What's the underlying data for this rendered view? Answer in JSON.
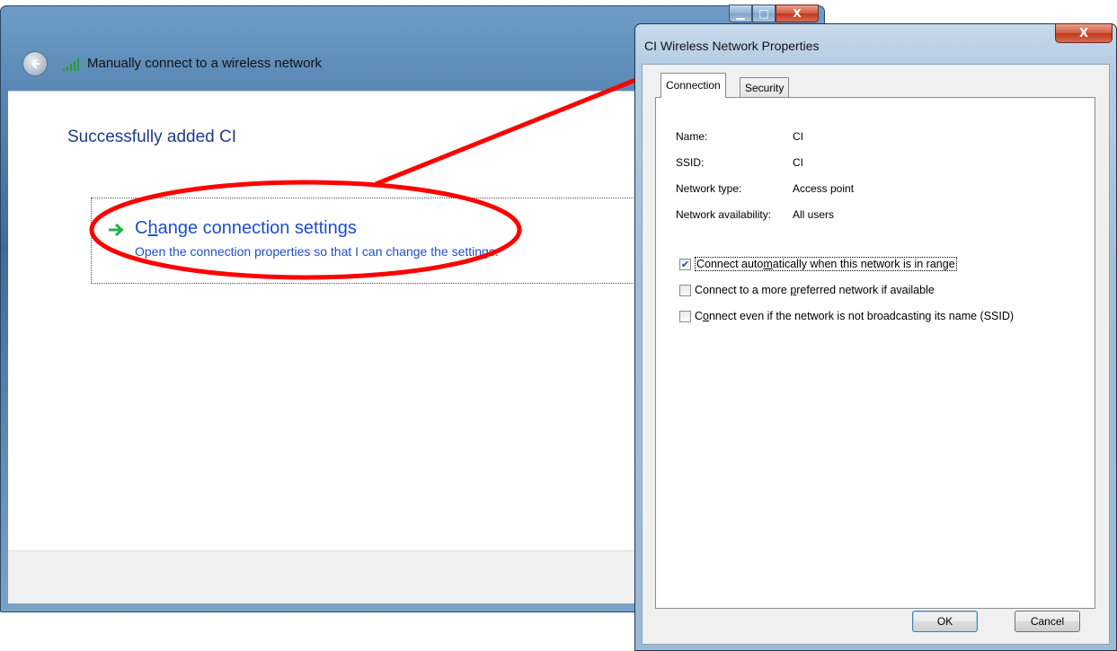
{
  "wizard": {
    "title": "Manually connect to a wireless network",
    "heading": "Successfully added CI",
    "change_link": {
      "title_prefix": "C",
      "title_accel": "h",
      "title_rest": "ange connection settings",
      "description": "Open the connection properties so that I can change the settings."
    },
    "caption_buttons": {
      "minimize": "▁",
      "maximize": "□",
      "close": "X"
    }
  },
  "dialog": {
    "title": "CI Wireless Network Properties",
    "close_label": "X",
    "tabs": [
      "Connection",
      "Security"
    ],
    "fields": [
      {
        "label": "Name:",
        "value": "CI"
      },
      {
        "label": "SSID:",
        "value": "CI"
      },
      {
        "label": "Network type:",
        "value": "Access point"
      },
      {
        "label": "Network availability:",
        "value": "All users"
      }
    ],
    "checkboxes": [
      {
        "pre": "Connect auto",
        "accel": "m",
        "post": "atically when this network is in range",
        "checked": true
      },
      {
        "pre": "Connect to a more ",
        "accel": "p",
        "post": "referred network if available",
        "checked": false
      },
      {
        "pre": "C",
        "accel": "o",
        "post": "nnect even if the network is not broadcasting its name (SSID)",
        "checked": false
      }
    ],
    "ok_label": "OK",
    "cancel_label": "Cancel"
  },
  "colors": {
    "annotation": "#ff0000",
    "link": "#1d4ec9",
    "heading": "#1e3b8c"
  }
}
